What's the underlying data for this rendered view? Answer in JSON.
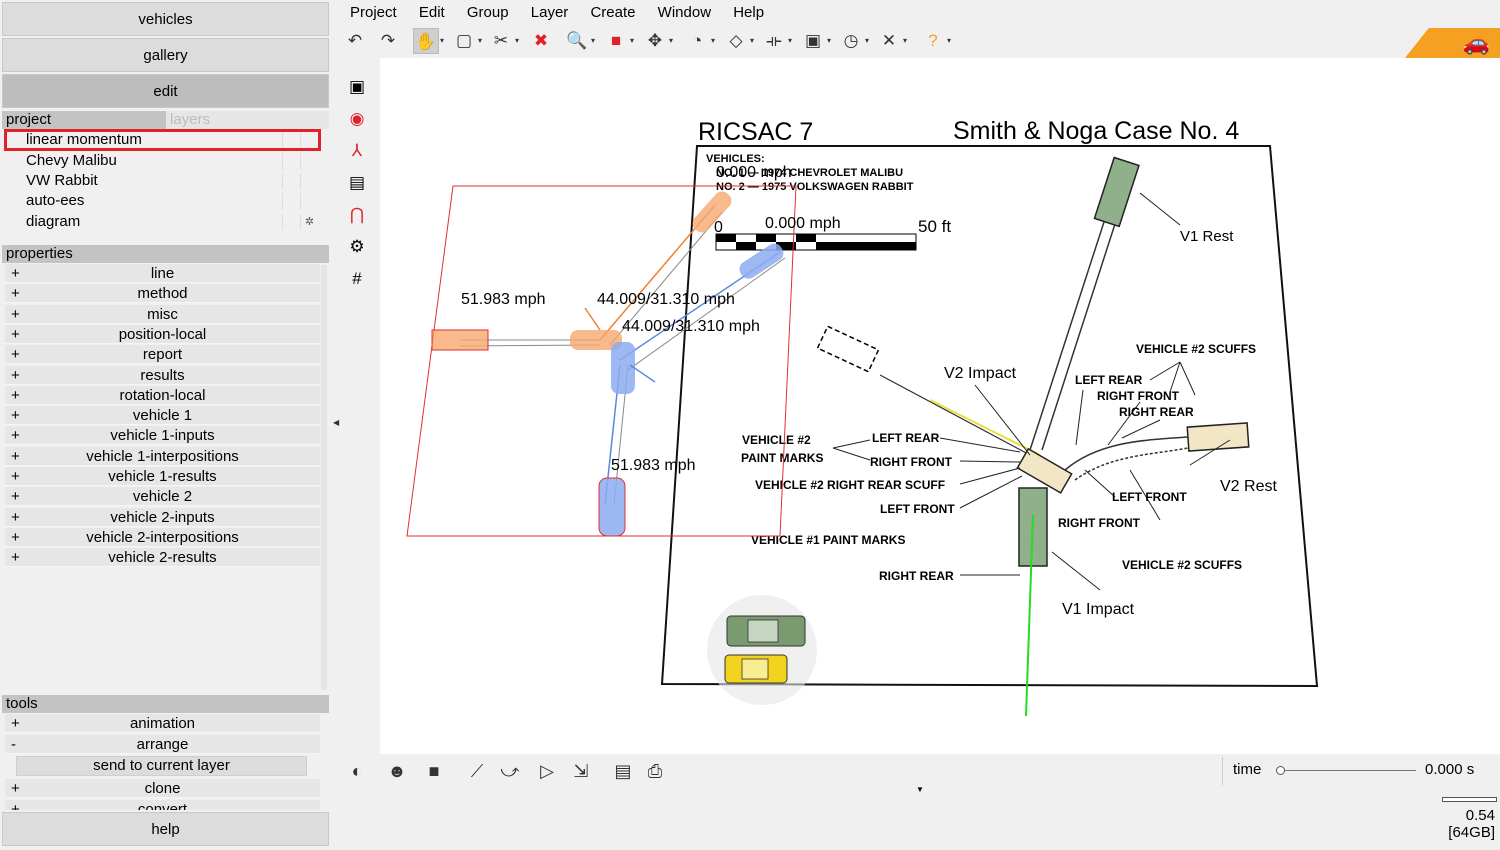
{
  "nav": {
    "vehicles": "vehicles",
    "gallery": "gallery",
    "edit": "edit",
    "help": "help"
  },
  "project": {
    "tab_project": "project",
    "tab_layers": "layers",
    "items": [
      "linear momentum",
      "Chevy Malibu",
      "VW Rabbit",
      "auto-ees",
      "diagram"
    ],
    "selected": "linear momentum",
    "diagram_icon": "gear-icon"
  },
  "properties": {
    "header": "properties",
    "items": [
      "line",
      "method",
      "misc",
      "position-local",
      "report",
      "results",
      "rotation-local",
      "vehicle 1",
      "vehicle 1-inputs",
      "vehicle 1-interpositions",
      "vehicle 1-results",
      "vehicle 2",
      "vehicle 2-inputs",
      "vehicle 2-interpositions",
      "vehicle 2-results"
    ],
    "expander": "+"
  },
  "tools": {
    "header": "tools",
    "items": [
      {
        "label": "animation",
        "state": "+"
      },
      {
        "label": "arrange",
        "state": "-"
      },
      {
        "label": "clone",
        "state": "+"
      },
      {
        "label": "convert",
        "state": "+"
      }
    ],
    "sub_button": "send to current layer"
  },
  "menu": [
    "Project",
    "Edit",
    "Group",
    "Layer",
    "Create",
    "Window",
    "Help"
  ],
  "toolbar": {
    "icons": [
      "undo-icon",
      "redo-icon",
      "pan-hand-icon",
      "select-rect-icon",
      "scissors-icon",
      "delete-x-icon",
      "zoom-icon",
      "cube-icon",
      "move-icon",
      "rotate-icon",
      "tilt-icon",
      "measure-icon",
      "frame-icon",
      "gauge-icon",
      "tool-icon",
      "help-icon"
    ],
    "glyphs": [
      "↶",
      "↷",
      "✋",
      "▢",
      "✂",
      "✖",
      "🔍",
      "■",
      "✥",
      "◔",
      "◇",
      "⟛",
      "▣",
      "◷",
      "✕",
      "?"
    ],
    "colors": {
      "delete": "#e0202a",
      "cube": "#e0202a",
      "help": "#f0a030",
      "logo": "#f5a020"
    }
  },
  "vtools": [
    "camera-icon",
    "target-icon",
    "axes-icon",
    "image-icon",
    "magnet-icon",
    "settings-icon",
    "grid-icon"
  ],
  "diagram": {
    "title_left": "RICSAC 7",
    "title_right": "Smith & Noga Case No. 4",
    "vehicles_hdr": "VEHICLES:",
    "vehicle1": "NO. 1 — 1974 CHEVROLET MALIBU",
    "vehicle2": "NO. 2 — 1975 VOLKSWAGEN RABBIT",
    "scale_zero": "0",
    "scale_end": "50 ft",
    "v1_rest": "V1 Rest",
    "v2_rest": "V2 Rest",
    "v2_impact": "V2 Impact",
    "v1_impact": "V1 Impact",
    "v2_scuffs_top": "VEHICLE #2 SCUFFS",
    "v2_scuffs_bottom": "VEHICLE #2 SCUFFS",
    "left_rear_a": "LEFT REAR",
    "right_front_a": "RIGHT FRONT",
    "right_rear_a": "RIGHT REAR",
    "v2_paint": "VEHICLE #2",
    "v2_paint2": "PAINT MARKS",
    "left_rear_b": "LEFT REAR",
    "right_front_b": "RIGHT FRONT",
    "v2_rr_scuff": "VEHICLE #2 RIGHT REAR SCUFF",
    "left_front_a": "LEFT FRONT",
    "v1_paint": "VEHICLE #1 PAINT MARKS",
    "right_rear_b": "RIGHT REAR",
    "left_front_b": "LEFT FRONT",
    "right_front_c": "RIGHT FRONT",
    "speed_top": "0.000 mph",
    "speed_scale": "0.000 mph",
    "speed_v1_in": "51.983 mph",
    "speed_out_a": "44.009/31.310 mph",
    "speed_out_b": "44.009/31.310 mph",
    "speed_v2_in": "51.983 mph"
  },
  "bottom": {
    "icons": [
      "shading-icon",
      "head-icon",
      "fill-icon",
      "chart-icon",
      "animate-icon",
      "play-icon",
      "export-icon",
      "report-icon",
      "print-icon"
    ],
    "glyphs": [
      "◐",
      "☻",
      "■",
      "⟋",
      "⤻",
      "▷",
      "⇲",
      "▤",
      "⎙"
    ],
    "time_label": "time",
    "time_value": "0.000 s",
    "time_fraction": 0,
    "memory_value": "0.54",
    "memory_total": "[64GB]"
  }
}
